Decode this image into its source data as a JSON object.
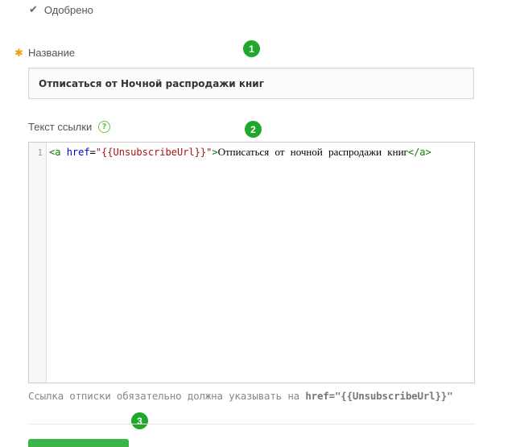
{
  "status": {
    "icon": "check-icon",
    "glyph": "✔",
    "text": "Одобрено"
  },
  "markers": [
    "1",
    "2",
    "3"
  ],
  "name_field": {
    "label": "Название",
    "required_mark": "✱",
    "value": "Отписаться от Ночной распродажи книг"
  },
  "link_field": {
    "label": "Текст ссылки",
    "help_icon": "question-icon",
    "help_glyph": "?",
    "line_number": "1",
    "code": {
      "tag_open": "<a",
      "attr": "href",
      "eq": "=",
      "value": "\"{{UnsubscribeUrl}}\"",
      "tag_close_start": ">",
      "text": "Отписаться от ночной распродажи книг",
      "tag_end": "</a>"
    }
  },
  "hint": {
    "text": "Ссылка отписки обязательно должна указывать на ",
    "code": "href=\"{{UnsubscribeUrl}}\""
  },
  "colors": {
    "accent": "#1fa82a",
    "required": "#f39c12",
    "help": "#6cc04a"
  }
}
